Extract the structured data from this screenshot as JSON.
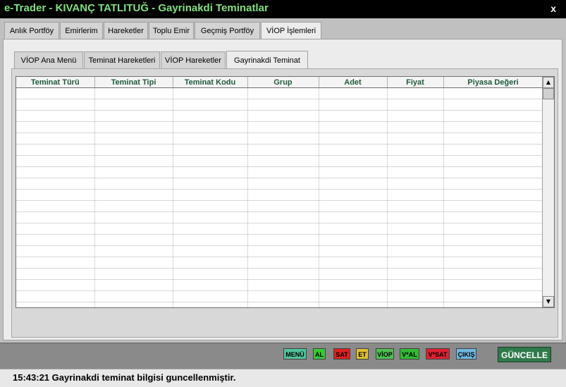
{
  "window": {
    "title": "e-Trader - KIVANÇ TATLITUĞ - Gayrinakdi Teminatlar",
    "close_label": "x"
  },
  "main_tabs": [
    {
      "label": "Anlık Portföy"
    },
    {
      "label": "Emirlerim"
    },
    {
      "label": "Hareketler"
    },
    {
      "label": "Toplu Emir"
    },
    {
      "label": "Geçmiş Portföy"
    },
    {
      "label": "VİOP İşlemleri"
    }
  ],
  "sub_tabs": [
    {
      "label": "VİOP Ana Menü"
    },
    {
      "label": "Teminat Hareketleri"
    },
    {
      "label": "VİOP Hareketler"
    },
    {
      "label": "Gayrinakdi Teminat"
    }
  ],
  "table": {
    "columns": [
      "Teminat Türü",
      "Teminat Tipi",
      "Teminat Kodu",
      "Grup",
      "Adet",
      "Fiyat",
      "Piyasa Değeri"
    ]
  },
  "scrollbar": {
    "up_icon": "▲",
    "down_icon": "▼"
  },
  "bottom_buttons": [
    {
      "label": "MENÜ",
      "bg": "#4fc49a",
      "fg": "#000000"
    },
    {
      "label": "AL",
      "bg": "#33cc33",
      "fg": "#000000"
    },
    {
      "label": "SAT",
      "bg": "#e02020",
      "fg": "#000000"
    },
    {
      "label": "ET",
      "bg": "#e0c030",
      "fg": "#000000"
    },
    {
      "label": "VİOP",
      "bg": "#50c050",
      "fg": "#000000"
    },
    {
      "label": "V*AL",
      "bg": "#33bb33",
      "fg": "#000000"
    },
    {
      "label": "V*SAT",
      "bg": "#e02030",
      "fg": "#000000"
    },
    {
      "label": "ÇIKIŞ",
      "bg": "#70b8e0",
      "fg": "#000000"
    }
  ],
  "update_button": {
    "label": "GÜNCELLE"
  },
  "status": {
    "text": "15:43:21 Gayrinakdi teminat bilgisi guncellenmiştir."
  }
}
